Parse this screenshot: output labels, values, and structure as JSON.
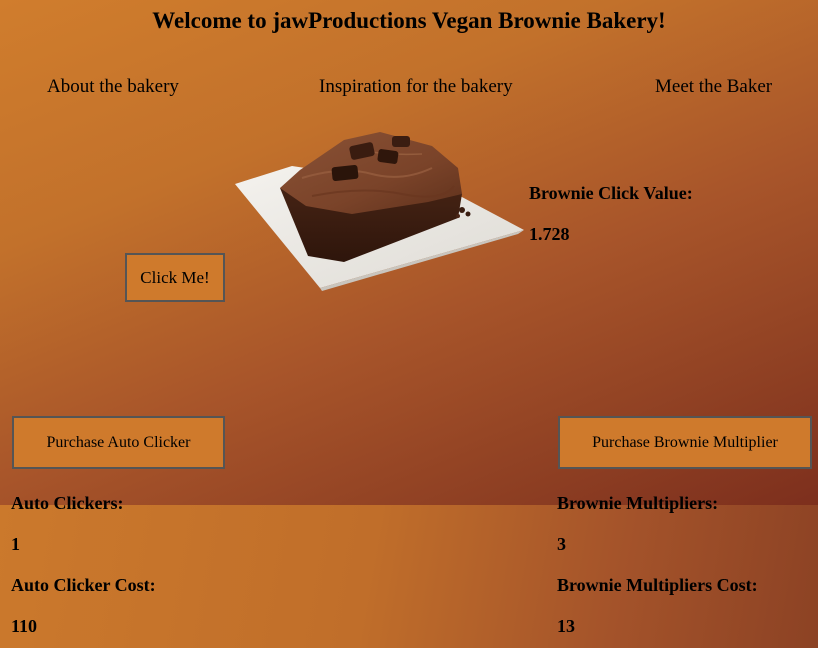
{
  "header": {
    "title": "Welcome to jawProductions Vegan Brownie Bakery!"
  },
  "nav": {
    "about": "About the bakery",
    "inspiration": "Inspiration for the bakery",
    "baker": "Meet the Baker"
  },
  "clicker": {
    "button_label": "Click Me!",
    "image_icon": "brownie-image"
  },
  "click_value": {
    "label": "Brownie Click Value:",
    "value": "1.728"
  },
  "auto_clicker": {
    "button_label": "Purchase Auto Clicker",
    "count_label": "Auto Clickers:",
    "count": "1",
    "cost_label": "Auto Clicker Cost:",
    "cost": "110"
  },
  "multiplier": {
    "button_label": "Purchase Brownie Multiplier",
    "count_label": "Brownie Multipliers:",
    "count": "3",
    "cost_label": "Brownie Multipliers Cost:",
    "cost": "13"
  },
  "colors": {
    "background_light": "#d07d2d",
    "background_dark": "#7d2f1d",
    "button_fill": "#cf7a2c",
    "button_border": "#555555"
  }
}
